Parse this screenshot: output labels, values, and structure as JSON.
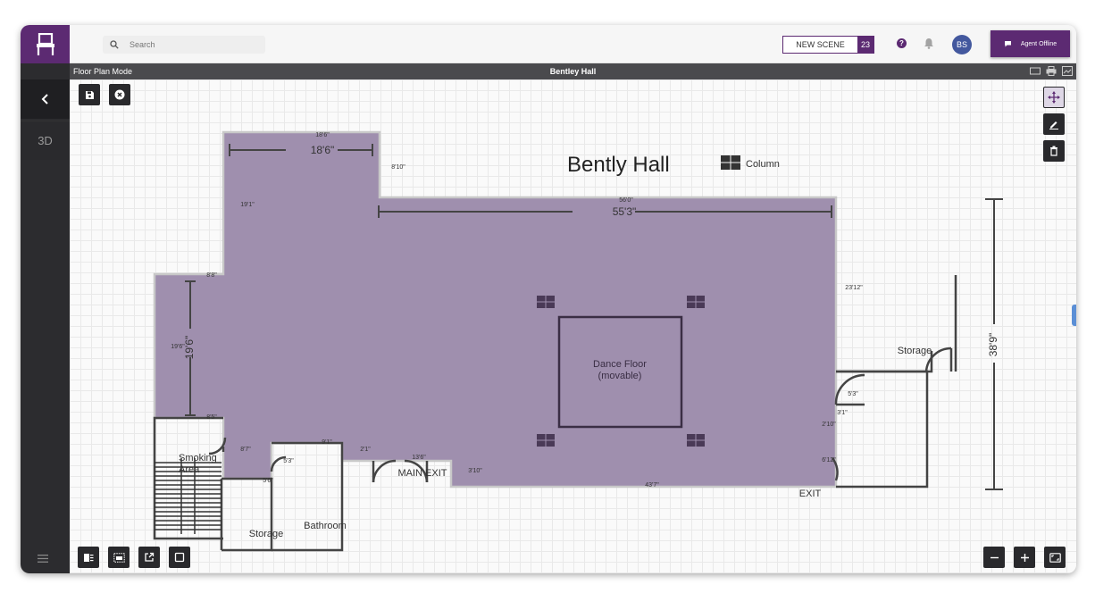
{
  "header": {
    "search_placeholder": "Search",
    "new_scene_label": "NEW SCENE",
    "new_scene_count": "23",
    "help_label": "?",
    "avatar_initials": "BS",
    "agent_status": "Agent Offline"
  },
  "sidebar": {
    "view_3d_label": "3D"
  },
  "modebar": {
    "mode_label": "Floor Plan Mode",
    "venue_title": "Bentley Hall"
  },
  "floorplan": {
    "title": "Bently Hall",
    "legend_label": "Column",
    "dance_floor_line1": "Dance Floor",
    "dance_floor_line2": "(movable)",
    "rooms": {
      "storage_right": "Storage",
      "storage_left": "Storage",
      "bathroom": "Bathroom",
      "smoking_line1": "Smoking",
      "smoking_line2": "Area",
      "main_exit": "MAIN EXIT",
      "exit": "EXIT"
    },
    "dimensions": {
      "top_small": "18'6\"",
      "top_large": "18'6\"",
      "d_8_10": "8'10\"",
      "d_19_1": "19'1\"",
      "d_56_0": "56'0\"",
      "d_55_3": "55'3\"",
      "d_8_8": "8'8\"",
      "d_19_6_small": "19'6\"",
      "d_19_6_vertical": "19'6\"",
      "d_23_12": "23'12\"",
      "d_38_9": "38'9\"",
      "d_8_5": "8'5\"",
      "d_8_7": "8'7\"",
      "d_9_1": "9'1\"",
      "d_2_1": "2'1\"",
      "d_5_3a": "5'3\"",
      "d_5_6": "5'6\"",
      "d_13_6": "13'6\"",
      "d_3_10": "3'10\"",
      "d_43_7": "43'7\"",
      "d_5_3b": "5'3\"",
      "d_3_1": "3'1\"",
      "d_2_10": "2'10\"",
      "d_6_12": "6'12\""
    }
  },
  "colors": {
    "brand": "#5c2a72",
    "floor_fill": "#9f8fae",
    "avatar": "#43589e"
  }
}
